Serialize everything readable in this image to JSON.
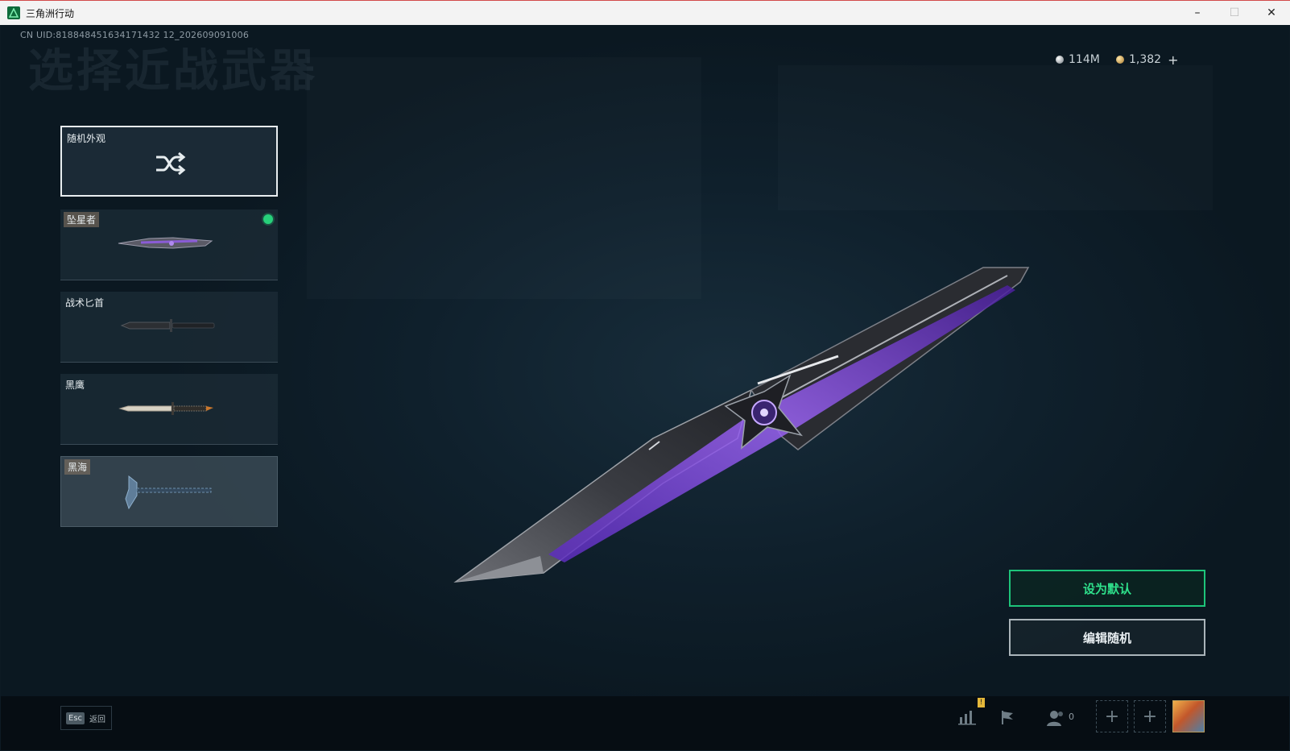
{
  "window": {
    "title": "三角洲行动",
    "controls": {
      "minimize": "–",
      "maximize": "☐",
      "close": "✕"
    }
  },
  "header": {
    "uid": "CN UID:818848451634171432 12_202609091006",
    "page_title": "选择近战武器"
  },
  "currency": {
    "silver": "114M",
    "gold": "1,382",
    "add": "+"
  },
  "weapons": [
    {
      "label": "随机外观",
      "icon": "shuffle-icon",
      "selected": true
    },
    {
      "label": "坠星者",
      "equipped": true
    },
    {
      "label": "战术匕首"
    },
    {
      "label": "黑鹰"
    },
    {
      "label": "黑海"
    }
  ],
  "actions": {
    "set_default": "设为默认",
    "edit_random": "编辑随机"
  },
  "bottom": {
    "esc_key": "Esc",
    "esc_label": "返回",
    "badge": "!",
    "friends": "0",
    "slot_plus": "+"
  },
  "colors": {
    "accent_green": "#2ee08b",
    "background": "#0d1a24",
    "equipped_dot": "#27d07a"
  }
}
